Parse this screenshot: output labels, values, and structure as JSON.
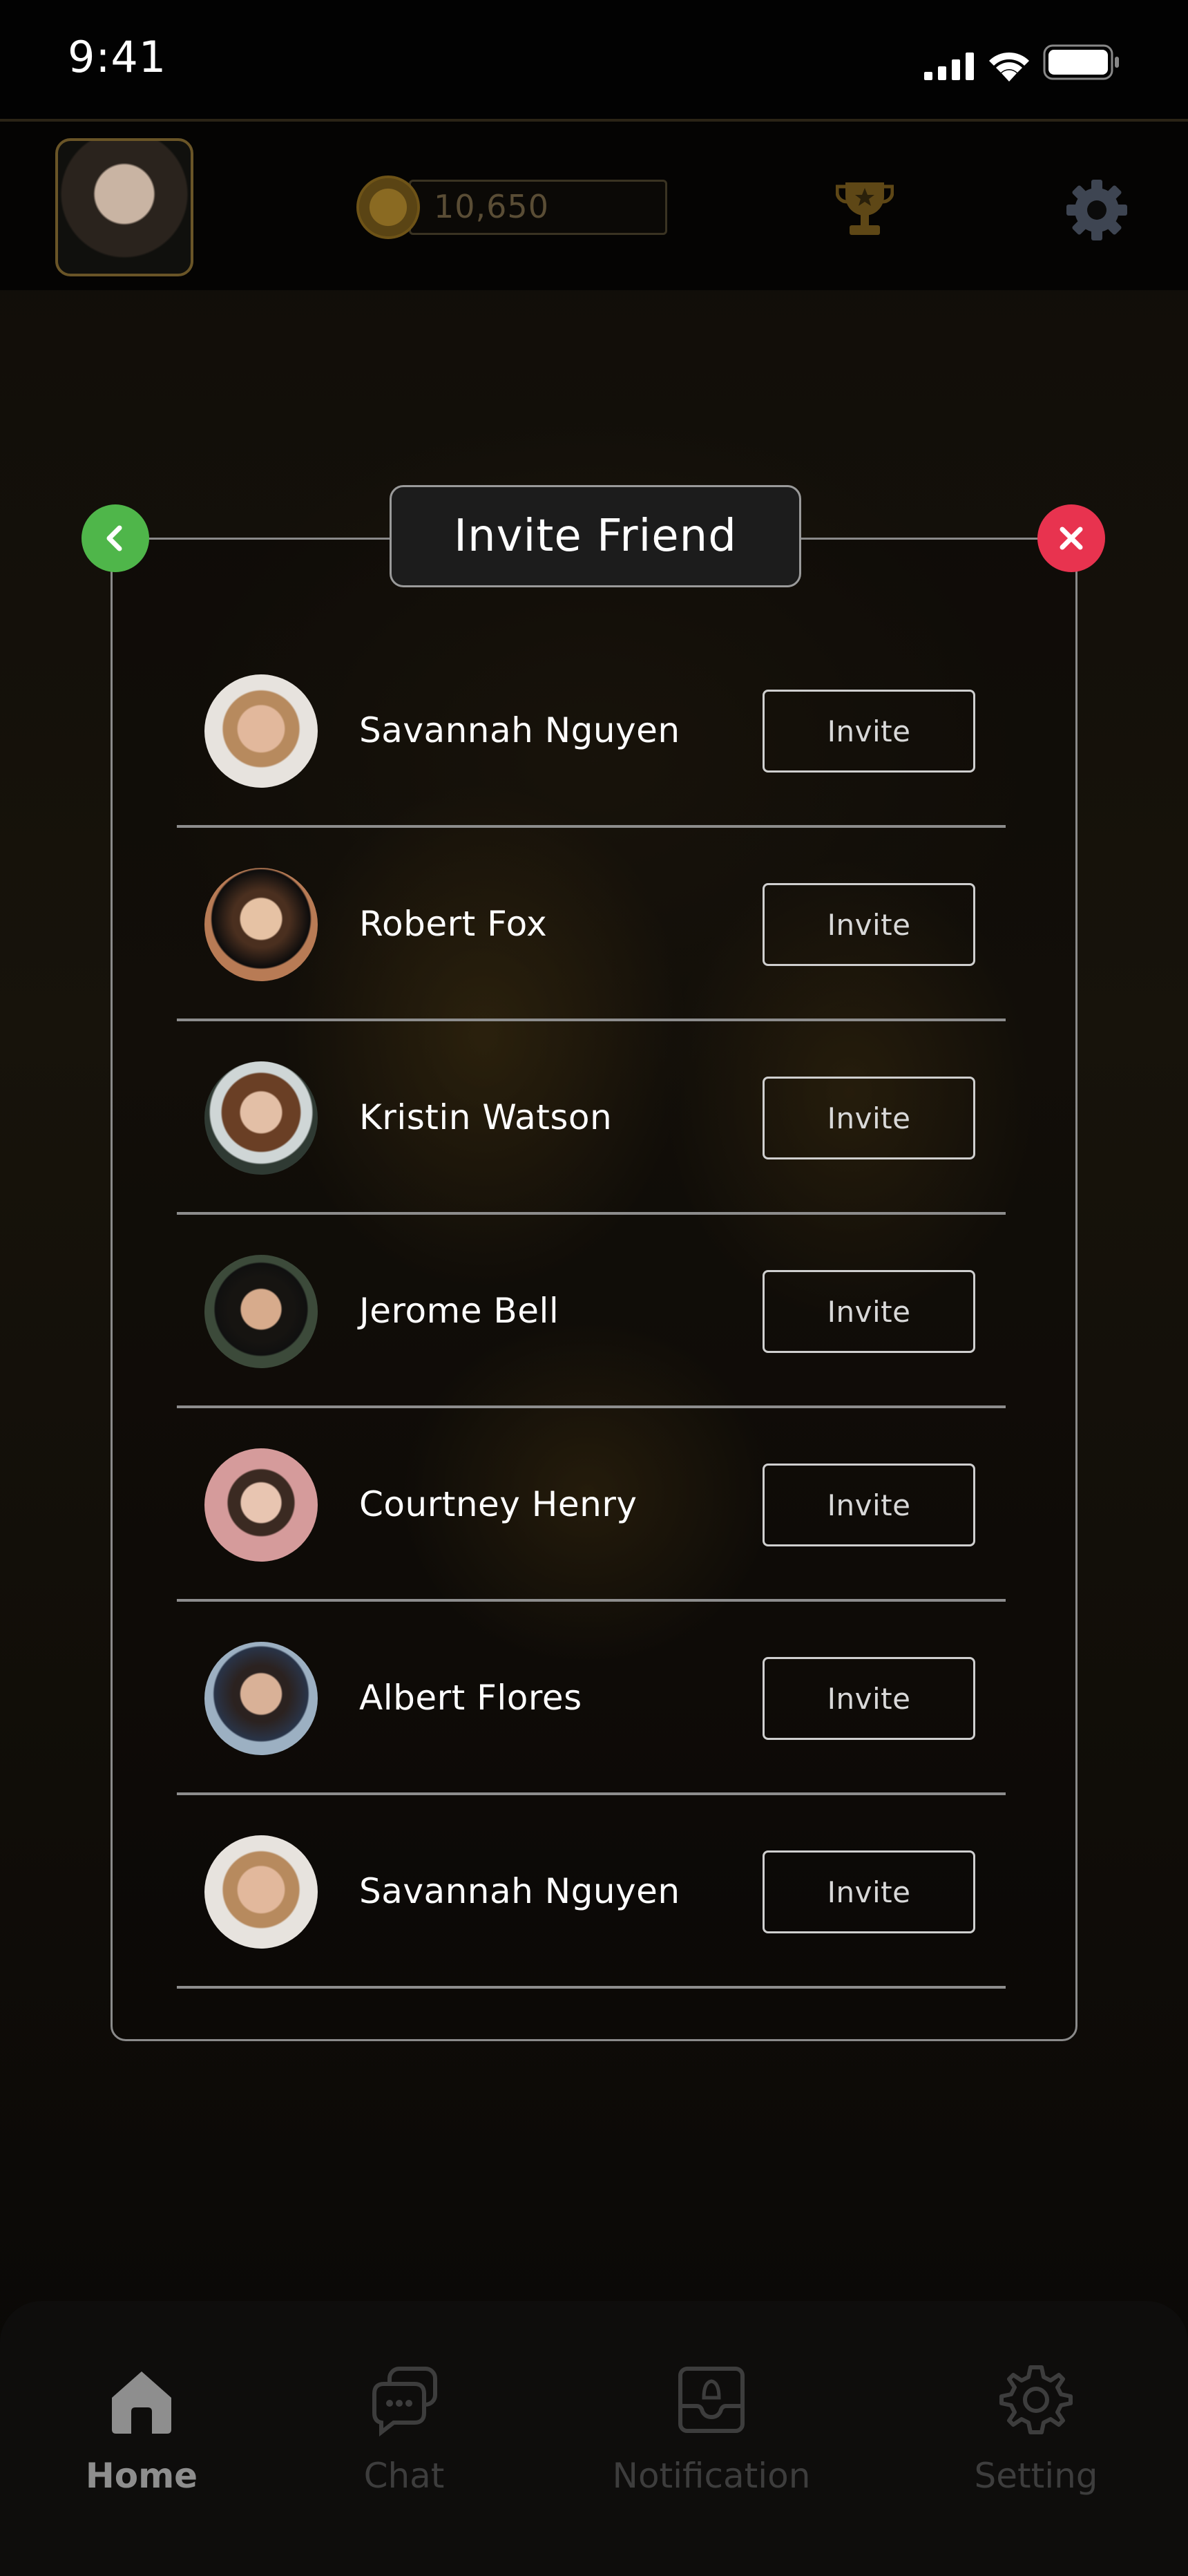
{
  "status_bar": {
    "time": "9:41"
  },
  "top_bar": {
    "coins": "10,650"
  },
  "panel": {
    "title": "Invite Friend"
  },
  "friends": [
    {
      "name": "Savannah Nguyen",
      "invite_label": "Invite"
    },
    {
      "name": "Robert Fox",
      "invite_label": "Invite"
    },
    {
      "name": "Kristin Watson",
      "invite_label": "Invite"
    },
    {
      "name": "Jerome Bell",
      "invite_label": "Invite"
    },
    {
      "name": "Courtney Henry",
      "invite_label": "Invite"
    },
    {
      "name": "Albert Flores",
      "invite_label": "Invite"
    },
    {
      "name": "Savannah Nguyen",
      "invite_label": "Invite"
    }
  ],
  "bottom_nav": {
    "items": [
      {
        "label": "Home",
        "icon": "home-icon",
        "active": true
      },
      {
        "label": "Chat",
        "icon": "chat-icon",
        "active": false
      },
      {
        "label": "Notification",
        "icon": "notification-icon",
        "active": false
      },
      {
        "label": "Setting",
        "icon": "settings-icon",
        "active": false
      }
    ]
  },
  "colors": {
    "back_button": "#4fb64a",
    "close_button": "#e8334f",
    "gold_accent": "#6a5527"
  }
}
